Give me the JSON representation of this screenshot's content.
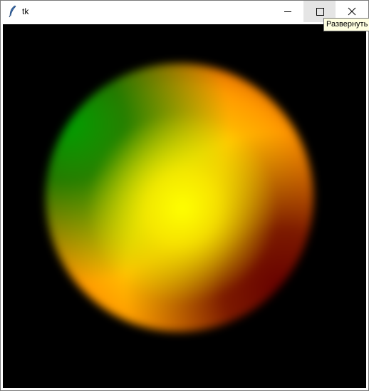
{
  "window": {
    "title": "tk",
    "icon": "feather-icon"
  },
  "controls": {
    "minimize_icon": "minimize-icon",
    "maximize_icon": "maximize-icon",
    "close_icon": "close-icon"
  },
  "tooltip": {
    "text": "Развернуть"
  },
  "canvas": {
    "background": "#000000",
    "sphere_colors": {
      "highlight": "#ffff00",
      "midtone": "#ff9900",
      "green": "#00a000",
      "red": "#660000"
    }
  }
}
